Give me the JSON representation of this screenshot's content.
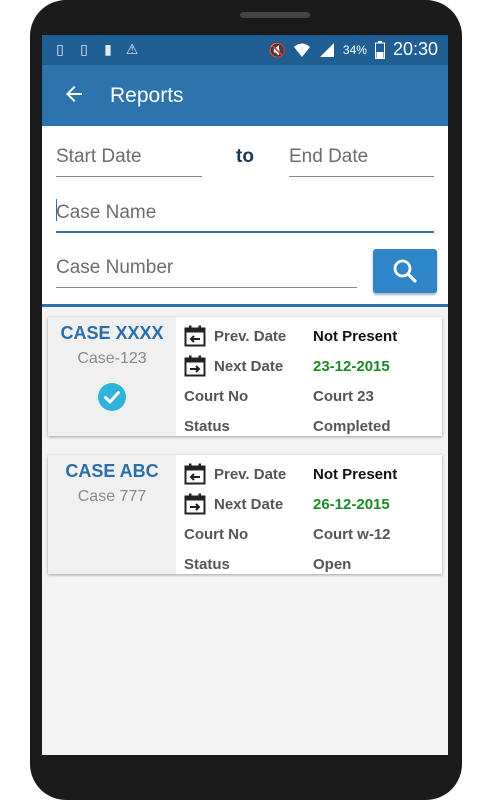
{
  "status_bar": {
    "left_icons": [
      "sim-card-icon",
      "sim-card-icon",
      "sd-card-icon",
      "warning-icon"
    ],
    "battery": "34%",
    "time": "20:30"
  },
  "app_bar": {
    "title": "Reports",
    "back_icon": "arrow-back-icon"
  },
  "filters": {
    "start_date_placeholder": "Start Date",
    "to_label": "to",
    "end_date_placeholder": "End Date",
    "case_name_placeholder": "Case Name",
    "case_number_placeholder": "Case Number",
    "search_icon": "search-icon"
  },
  "colors": {
    "app_bar": "#2d73ae",
    "status_bar": "#1f5f93",
    "accent": "#2e86c9",
    "date_green": "#1c8a23"
  },
  "labels": {
    "prev_date": "Prev. Date",
    "next_date": "Next Date",
    "court_no": "Court No",
    "status": "Status"
  },
  "cases": [
    {
      "title": "CASE XXXX",
      "number": "Case-123",
      "completed": true,
      "prev_date": "Not Present",
      "next_date": "23-12-2015",
      "court_no": "Court 23",
      "status": "Completed"
    },
    {
      "title": "CASE ABC",
      "number": "Case 777",
      "completed": false,
      "prev_date": "Not Present",
      "next_date": "26-12-2015",
      "court_no": "Court w-12",
      "status": "Open"
    }
  ]
}
